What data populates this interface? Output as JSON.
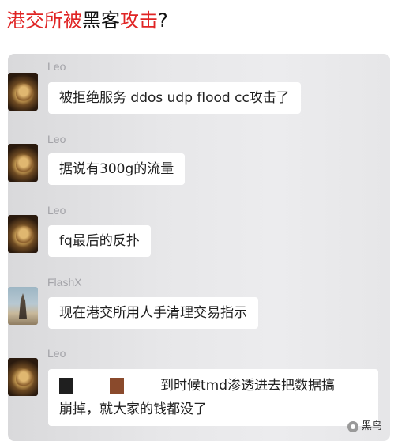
{
  "headline": {
    "parts": [
      {
        "text": "港交所被",
        "color": "#e02424"
      },
      {
        "text": "黑客",
        "color": "#111111"
      },
      {
        "text": "攻击",
        "color": "#e02424"
      },
      {
        "text": "?",
        "color": "#111111"
      }
    ]
  },
  "messages": [
    {
      "sender": "Leo",
      "avatar": "leo-avatar",
      "text": "被拒绝服务 ddos udp flood cc攻击了"
    },
    {
      "sender": "Leo",
      "avatar": "leo-avatar",
      "text": "据说有300g的流量"
    },
    {
      "sender": "Leo",
      "avatar": "leo-avatar",
      "text": "fq最后的反扑"
    },
    {
      "sender": "FlashX",
      "avatar": "flashx-avatar",
      "text": "现在港交所用人手清理交易指示"
    },
    {
      "sender": "Leo",
      "avatar": "leo-avatar",
      "line1": "到时候tmd渗透进去把数据搞",
      "line2": "崩掉，就大家的钱都没了"
    }
  ],
  "watermark": {
    "text": "黑鸟",
    "icon": "wechat-icon"
  }
}
